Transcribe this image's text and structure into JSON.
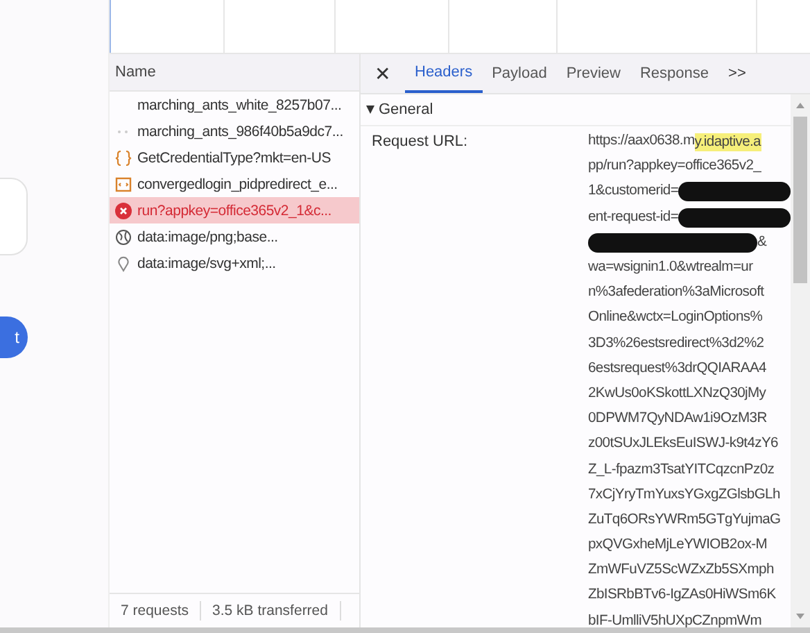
{
  "page": {
    "button_label": "t"
  },
  "requests": {
    "header": "Name",
    "rows": [
      {
        "name": "marching_ants_white_8257b07...",
        "kind": "blank",
        "selected": false
      },
      {
        "name": "marching_ants_986f40b5a9dc7...",
        "kind": "dots",
        "selected": false
      },
      {
        "name": "GetCredentialType?mkt=en-US",
        "kind": "json",
        "selected": false
      },
      {
        "name": "convergedlogin_pidpredirect_e...",
        "kind": "doc",
        "selected": false
      },
      {
        "name": "run?appkey=office365v2_1&c...",
        "kind": "error",
        "selected": true
      },
      {
        "name": "data:image/png;base...",
        "kind": "globe",
        "selected": false
      },
      {
        "name": "data:image/svg+xml;...",
        "kind": "pin",
        "selected": false
      }
    ]
  },
  "status_bar": [
    "7 requests",
    "3.5 kB transferred"
  ],
  "details": {
    "close": "✕",
    "tabs": [
      {
        "label": "Headers",
        "selected": true
      },
      {
        "label": "Payload",
        "selected": false
      },
      {
        "label": "Preview",
        "selected": false
      },
      {
        "label": "Response",
        "selected": false
      }
    ],
    "more": ">>",
    "section": {
      "title": "General",
      "expanded": true
    },
    "field_label": "Request URL:",
    "url_lines": [
      {
        "text": "https://aax0638.m",
        "highlight": "y.idaptive.a"
      },
      {
        "text": "pp/run?appkey=office365v2_"
      },
      {
        "text": "1&customerid=",
        "redacted_after": true
      },
      {
        "text": "ent-request-id=",
        "redacted_after": true
      },
      {
        "text": "&",
        "redacted_before": true
      },
      {
        "text": "wa=wsignin1.0&wtrealm=ur"
      },
      {
        "text": "n%3afederation%3aMicrosoft"
      },
      {
        "text": "Online&wctx=LoginOptions%"
      },
      {
        "text": "3D3%26estsredirect%3d2%2"
      },
      {
        "text": "6estsrequest%3drQQIARAA4"
      },
      {
        "text": "2KwUs0oKSkottLXNzQ30jMy"
      },
      {
        "text": "0DPWM7QyNDAw1i9OzM3R"
      },
      {
        "text": "z00tSUxJLEksEuISWJ-k9t4zY6"
      },
      {
        "text": "Z_L-fpazm3TsatYITCqzcnPz0z"
      },
      {
        "text": "7xCjYryTmYuxsYGxgZGlsbGLh"
      },
      {
        "text": "ZuTq6ORsYWRm5GTgYujmaG"
      },
      {
        "text": "pxQVGxheMjLeYWIOB2ox-M"
      },
      {
        "text": "ZmWFuVZ5ScWZxZb5SXmph"
      },
      {
        "text": "ZbISRbBTv6-IgZAs0HiWSm6K"
      },
      {
        "text": "bIF-UmlliV5hUXpCZnpmWm"
      }
    ]
  }
}
